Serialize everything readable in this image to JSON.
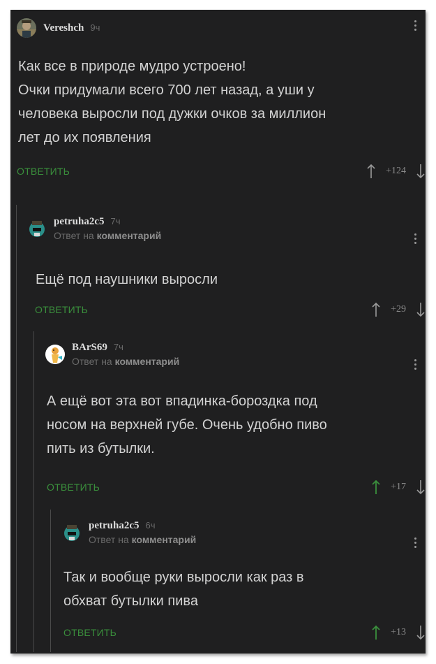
{
  "comments": [
    {
      "author": "Vereshch",
      "time": "9ч",
      "reply_to": null,
      "lines": [
        "Как все в природе мудро устроено!",
        "Очки придумали всего 700 лет назад, а уши у",
        "человека выросли под дужки очков за миллион",
        "лет до их появления"
      ],
      "reply_label": "ОТВЕТИТЬ",
      "score": "+124",
      "upvoted": false
    },
    {
      "author": "petruha2c5",
      "time": "7ч",
      "reply_to": {
        "prefix": "Ответ на",
        "target": "комментарий"
      },
      "lines": [
        "Ещё под наушники выросли"
      ],
      "reply_label": "ОТВЕТИТЬ",
      "score": "+29",
      "upvoted": false
    },
    {
      "author": "BArS69",
      "time": "7ч",
      "reply_to": {
        "prefix": "Ответ на",
        "target": "комментарий"
      },
      "lines": [
        "А ещё вот эта вот впадинка-бороздка под",
        "носом на верхней губе. Очень удобно пиво",
        "пить из бутылки."
      ],
      "reply_label": "ОТВЕТИТЬ",
      "score": "+17",
      "upvoted": true
    },
    {
      "author": "petruha2c5",
      "time": "6ч",
      "reply_to": {
        "prefix": "Ответ на",
        "target": "комментарий"
      },
      "lines": [
        "Так и вообще руки выросли как раз в",
        "обхват бутылки пива"
      ],
      "reply_label": "ОТВЕТИТЬ",
      "score": "+13",
      "upvoted": true
    }
  ],
  "colors": {
    "background": "#1f1f20",
    "text": "#d2d2d2",
    "reply_green": "#3a8f3c",
    "upvote_active": "#3a8f3c",
    "arrow_inactive": "#9a9a9a",
    "thread_line": "#4a4a4a"
  },
  "icons": {
    "menu": "kebab-menu-icon",
    "upvote": "arrow-up-icon",
    "downvote": "arrow-down-icon"
  }
}
